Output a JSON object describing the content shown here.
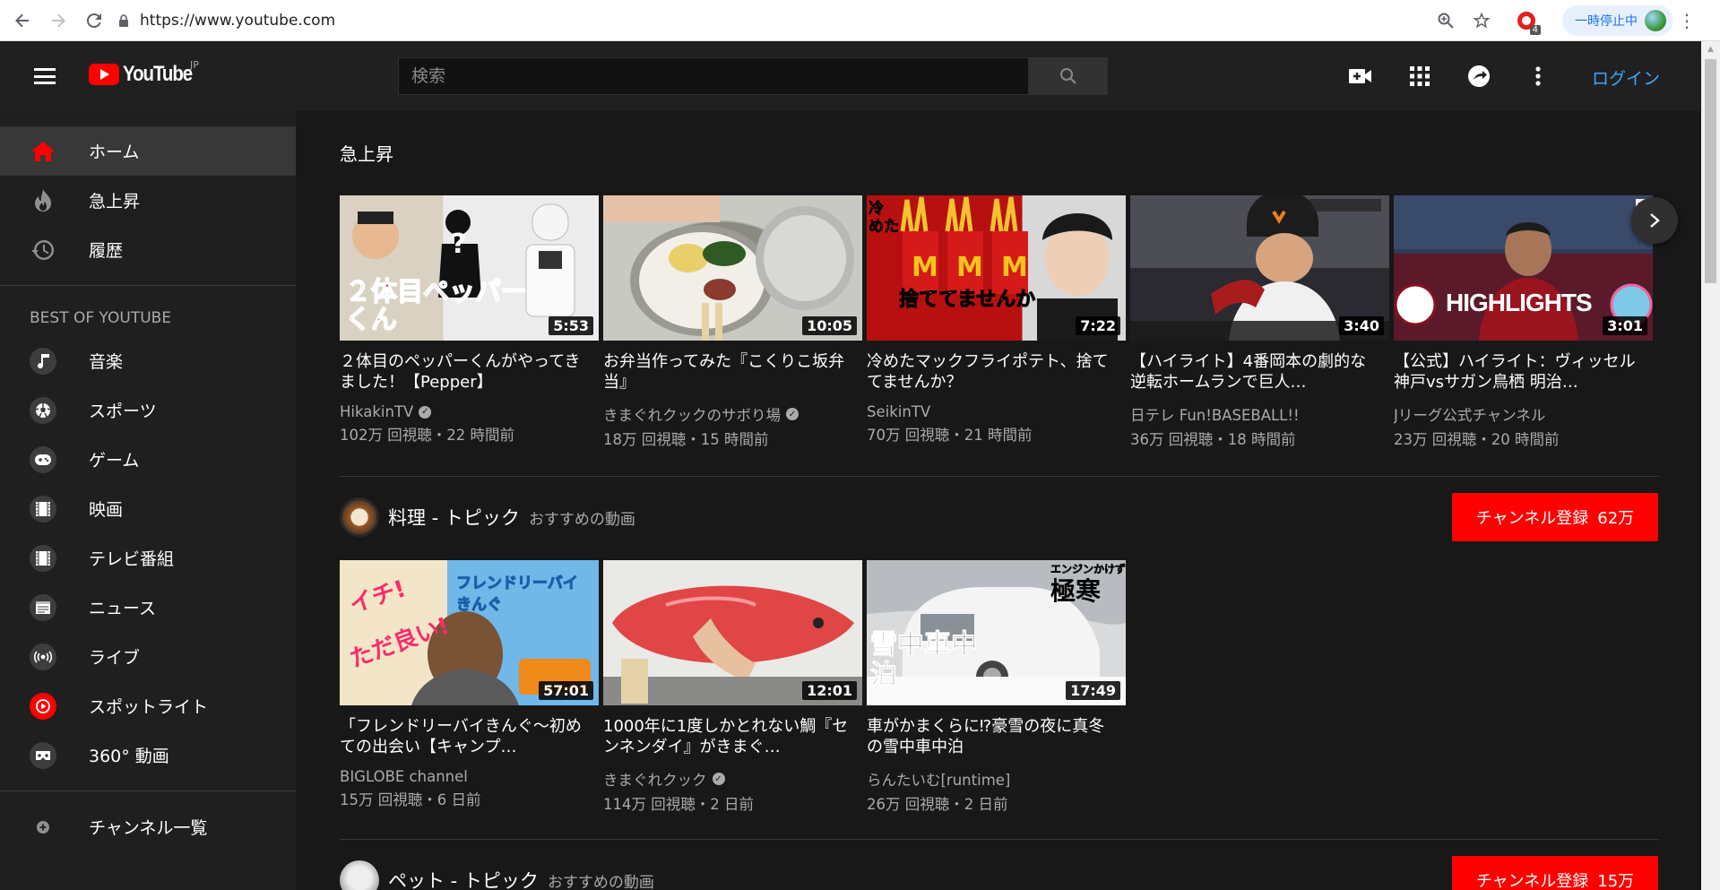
{
  "browser": {
    "url": "https://www.youtube.com",
    "pause_label": "一時停止中",
    "extension_badge": "4"
  },
  "masthead": {
    "logo_text": "YouTube",
    "region": "JP",
    "search_placeholder": "検索",
    "login_label": "ログイン"
  },
  "sidebar": {
    "main_items": [
      {
        "label": "ホーム",
        "icon": "home-icon"
      },
      {
        "label": "急上昇",
        "icon": "flame-icon"
      },
      {
        "label": "履歴",
        "icon": "history-icon"
      }
    ],
    "section_title": "BEST OF YOUTUBE",
    "best_items": [
      {
        "label": "音楽",
        "icon": "music-icon"
      },
      {
        "label": "スポーツ",
        "icon": "sports-icon"
      },
      {
        "label": "ゲーム",
        "icon": "gaming-icon"
      },
      {
        "label": "映画",
        "icon": "film-icon"
      },
      {
        "label": "テレビ番組",
        "icon": "tv-icon"
      },
      {
        "label": "ニュース",
        "icon": "news-icon"
      },
      {
        "label": "ライブ",
        "icon": "live-icon"
      },
      {
        "label": "スポットライト",
        "icon": "spotlight-icon"
      },
      {
        "label": "360° 動画",
        "icon": "vr-icon"
      }
    ],
    "channels_label": "チャンネル一覧"
  },
  "trending": {
    "title": "急上昇",
    "videos": [
      {
        "title": "２体目のペッパーくんがやってきました！【Pepper】",
        "channel": "HikakinTV",
        "verified": true,
        "meta": "102万 回視聴・22 時間前",
        "duration": "5:53",
        "thumb_text": "２体目ペッパーくん"
      },
      {
        "title": "お弁当作ってみた『こくりこ坂弁当』",
        "channel": "きまぐれクックのサボり場",
        "verified": true,
        "meta": "18万 回視聴・15 時間前",
        "duration": "10:05",
        "thumb_text": ""
      },
      {
        "title": "冷めたマックフライポテト、捨ててませんか？",
        "channel": "SeikinTV",
        "verified": false,
        "meta": "70万 回視聴・21 時間前",
        "duration": "7:22",
        "thumb_text": "捨ててませんか"
      },
      {
        "title": "【ハイライト】4番岡本の劇的な逆転ホームランで巨人…",
        "channel": "日テレ Fun!BASEBALL!!",
        "verified": false,
        "meta": "36万 回視聴・18 時間前",
        "duration": "3:40",
        "thumb_text": ""
      },
      {
        "title": "【公式】ハイライト：ヴィッセル神戸vsサガン鳥栖 明治…",
        "channel": "Jリーグ公式チャンネル",
        "verified": false,
        "meta": "23万 回視聴・20 時間前",
        "duration": "3:01",
        "thumb_text": "HIGHLIGHTS"
      }
    ]
  },
  "cooking": {
    "topic_name": "料理 - トピック",
    "topic_sub": "おすすめの動画",
    "subscribe_label": "チャンネル登録",
    "subscribe_count": "62万",
    "videos": [
      {
        "title": "「フレンドリーバイきんぐ〜初めての出会い【キャンプ…",
        "channel": "BIGLOBE channel",
        "verified": false,
        "meta": "15万 回視聴・6 日前",
        "duration": "57:01",
        "thumb_text": "フレンドリーバイきんぐ"
      },
      {
        "title": "1000年に1度しかとれない鯛『センネンダイ』がきまぐ…",
        "channel": "きまぐれクック",
        "verified": true,
        "meta": "114万 回視聴・2 日前",
        "duration": "12:01",
        "thumb_text": ""
      },
      {
        "title": "車がかまくらに⁉豪雪の夜に真冬の雪中車中泊",
        "channel": "らんたいむ[runtime]",
        "verified": false,
        "meta": "26万 回視聴・2 日前",
        "duration": "17:49",
        "thumb_text": "雪中車中泊"
      }
    ]
  },
  "pets": {
    "topic_name": "ペット - トピック",
    "topic_sub": "おすすめの動画",
    "subscribe_label": "チャンネル登録",
    "subscribe_count": "15万"
  }
}
